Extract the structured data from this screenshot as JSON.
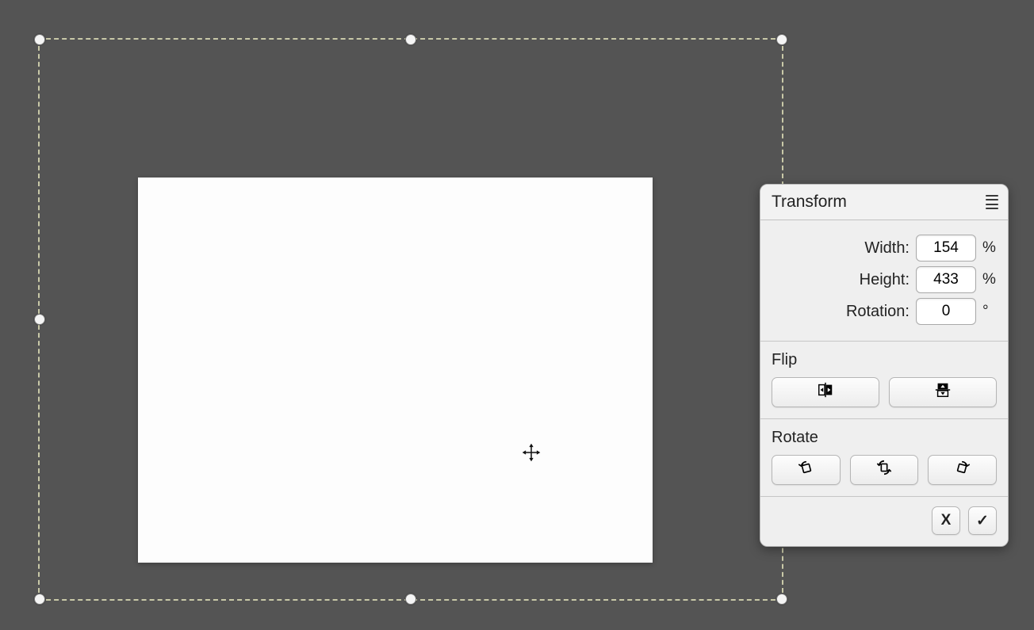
{
  "panel": {
    "title": "Transform",
    "fields": {
      "width_label": "Width:",
      "height_label": "Height:",
      "rotation_label": "Rotation:",
      "width_value": "154",
      "height_value": "433",
      "rotation_value": "0",
      "percent": "%",
      "degree": "°"
    },
    "flip_label": "Flip",
    "rotate_label": "Rotate",
    "cancel_label": "X",
    "confirm_label": "✓"
  }
}
